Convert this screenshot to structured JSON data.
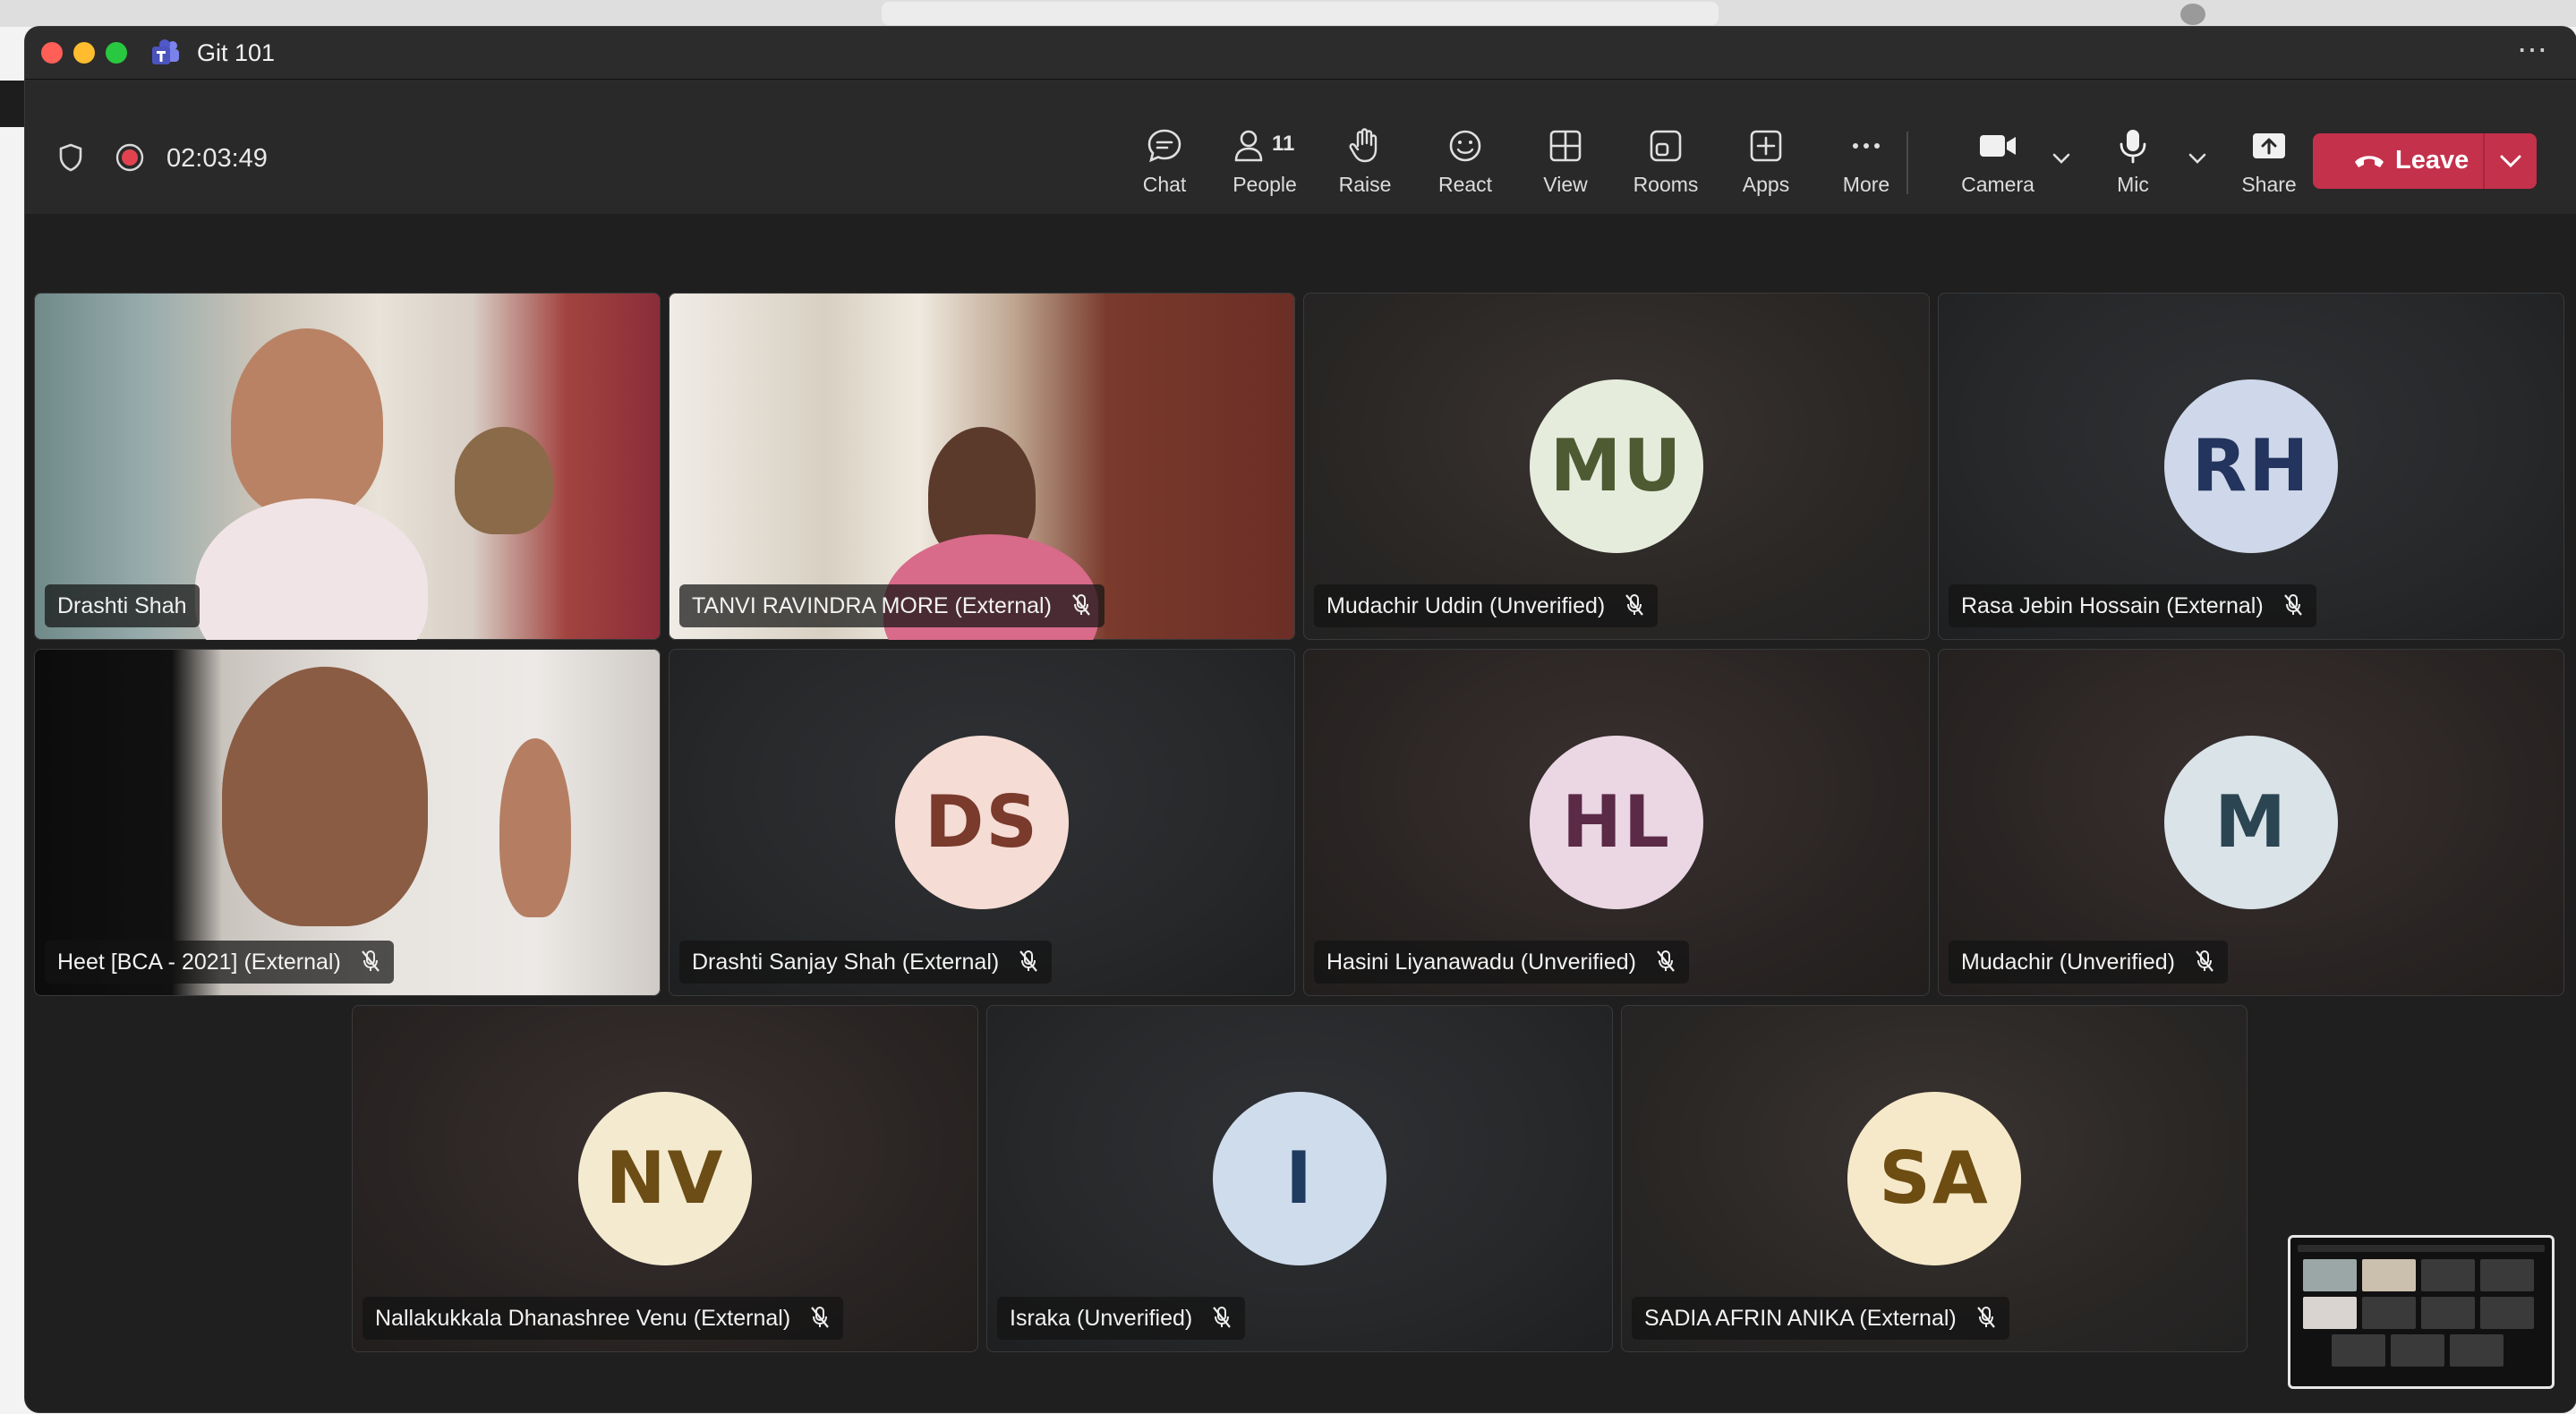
{
  "window": {
    "title": "Git 101",
    "more_label": "⋯"
  },
  "toolbar": {
    "timer": "02:03:49",
    "chat_label": "Chat",
    "people_label": "People",
    "people_count": "11",
    "raise_label": "Raise",
    "react_label": "React",
    "view_label": "View",
    "rooms_label": "Rooms",
    "apps_label": "Apps",
    "more_label": "More",
    "camera_label": "Camera",
    "mic_label": "Mic",
    "share_label": "Share",
    "leave_label": "Leave"
  },
  "participants": [
    {
      "name": "Drashti Shah",
      "initials": "",
      "video": true
    },
    {
      "name": "TANVI RAVINDRA MORE (External)",
      "initials": "",
      "video": true
    },
    {
      "name": "Mudachir Uddin (Unverified)",
      "initials": "MU",
      "avatar_bg": "#e6ecdc",
      "avatar_fg": "#4d5a32"
    },
    {
      "name": "Rasa Jebin Hossain (External)",
      "initials": "RH",
      "avatar_bg": "#cfd7ea",
      "avatar_fg": "#23355e"
    },
    {
      "name": "Heet [BCA - 2021] (External)",
      "initials": "",
      "video": true
    },
    {
      "name": "Drashti Sanjay Shah (External)",
      "initials": "DS",
      "avatar_bg": "#f5dcd5",
      "avatar_fg": "#7a3a2c"
    },
    {
      "name": "Hasini Liyanawadu (Unverified)",
      "initials": "HL",
      "avatar_bg": "#ead7e3",
      "avatar_fg": "#5b2a47"
    },
    {
      "name": "Mudachir (Unverified)",
      "initials": "M",
      "avatar_bg": "#d9e3e8",
      "avatar_fg": "#2b4552"
    },
    {
      "name": "Nallakukkala Dhanashree Venu (External)",
      "initials": "NV",
      "avatar_bg": "#f4ead0",
      "avatar_fg": "#6b4d15"
    },
    {
      "name": "Israka (Unverified)",
      "initials": "I",
      "avatar_bg": "#cfdcec",
      "avatar_fg": "#1f3b5f"
    },
    {
      "name": "SADIA AFRIN ANIKA (External)",
      "initials": "SA",
      "avatar_bg": "#f6e9c9",
      "avatar_fg": "#6d4d12"
    }
  ],
  "colors": {
    "leave": "#c4314b",
    "recording": "#e0434f"
  }
}
